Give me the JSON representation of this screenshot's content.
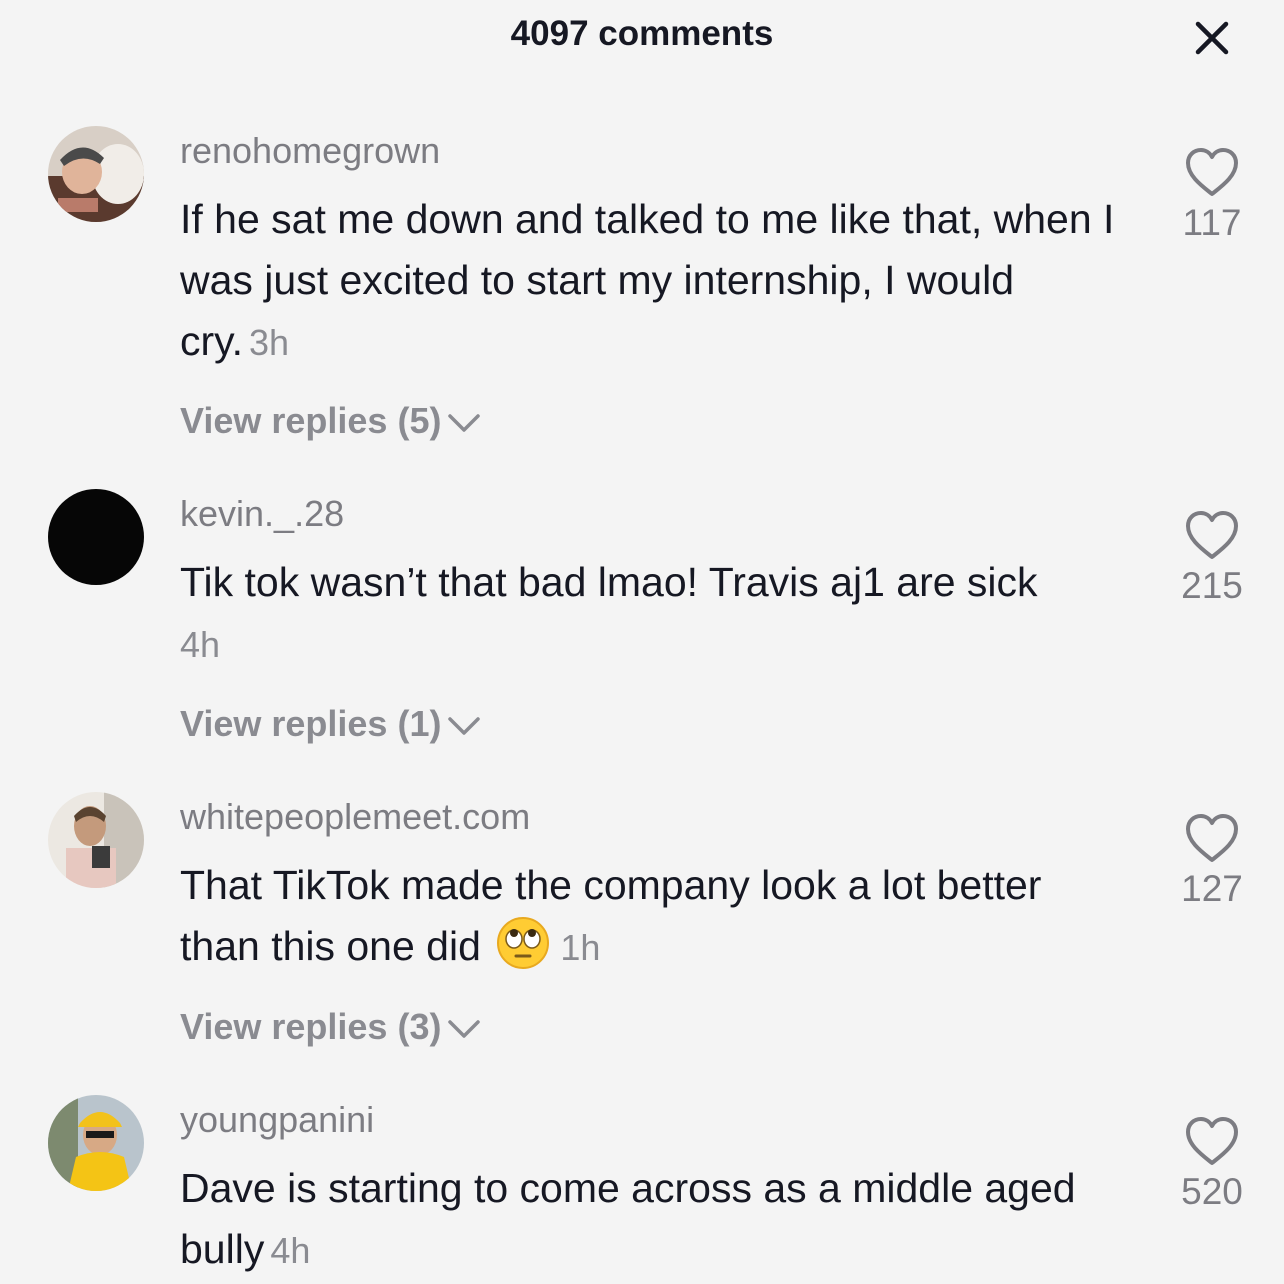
{
  "header": {
    "title": "4097 comments"
  },
  "comments": [
    {
      "username": "renohomegrown",
      "text": "If he sat me down and talked to me like that, when I was just excited to start my internship, I would cry.",
      "time": "3h",
      "replies_label": "View replies (5)",
      "likes": "117"
    },
    {
      "username": "kevin._.28",
      "text": "Tik tok wasn’t that bad lmao! Travis aj1 are sick",
      "time": "4h",
      "replies_label": "View replies (1)",
      "likes": "215"
    },
    {
      "username": "whitepeoplemeet.com",
      "text": "That TikTok made the company look a lot better than this one did",
      "emoji": "rolling-eyes-emoji",
      "time": "1h",
      "replies_label": "View replies (3)",
      "likes": "127"
    },
    {
      "username": "youngpanini",
      "text": "Dave is starting to come across as a middle aged bully",
      "time": "4h",
      "likes": "520"
    }
  ],
  "colors": {
    "background": "#f4f4f4",
    "primary_text": "#161823",
    "secondary_text": "#8a8b91"
  }
}
